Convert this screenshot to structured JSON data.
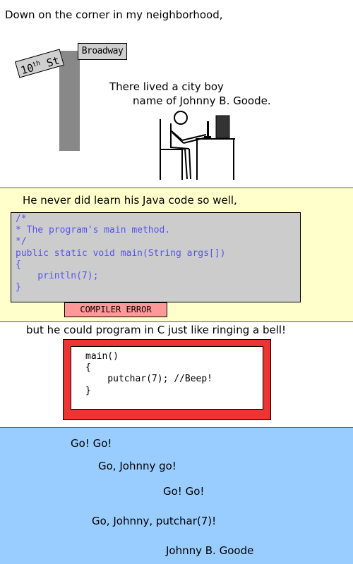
{
  "panel1": {
    "caption": "Down on the corner in my neighborhood,",
    "sign_broadway": "Broadway",
    "sign_street_num": "10",
    "sign_street_sup": "th",
    "sign_street_suffix": "St",
    "caption_line1": "There lived a city boy",
    "caption_line2": "name of Johnny B. Goode."
  },
  "panel2": {
    "caption": "He never did learn his Java code so well,",
    "code_lines": [
      "/*",
      "* The program's main method.",
      "*/",
      "public static void main(String args[])",
      "{",
      "    println(7);",
      "}"
    ],
    "error_label": "COMPILER ERROR"
  },
  "panel3": {
    "caption": "but he could program in C just like ringing a bell!",
    "code_lines": [
      "main()",
      "{",
      "    putchar(7); //Beep!",
      "}"
    ]
  },
  "panel4": {
    "lines": [
      "Go! Go!",
      "Go, Johnny go!",
      "Go! Go!",
      "Go, Johnny, putchar(7)!",
      "Johnny B. Goode"
    ]
  },
  "colors": {
    "panel2_bg": "#ffffcc",
    "panel4_bg": "#99ccff",
    "code_text": "#5555ee",
    "error_bg": "#ff9999",
    "c_frame": "#ee3333"
  }
}
